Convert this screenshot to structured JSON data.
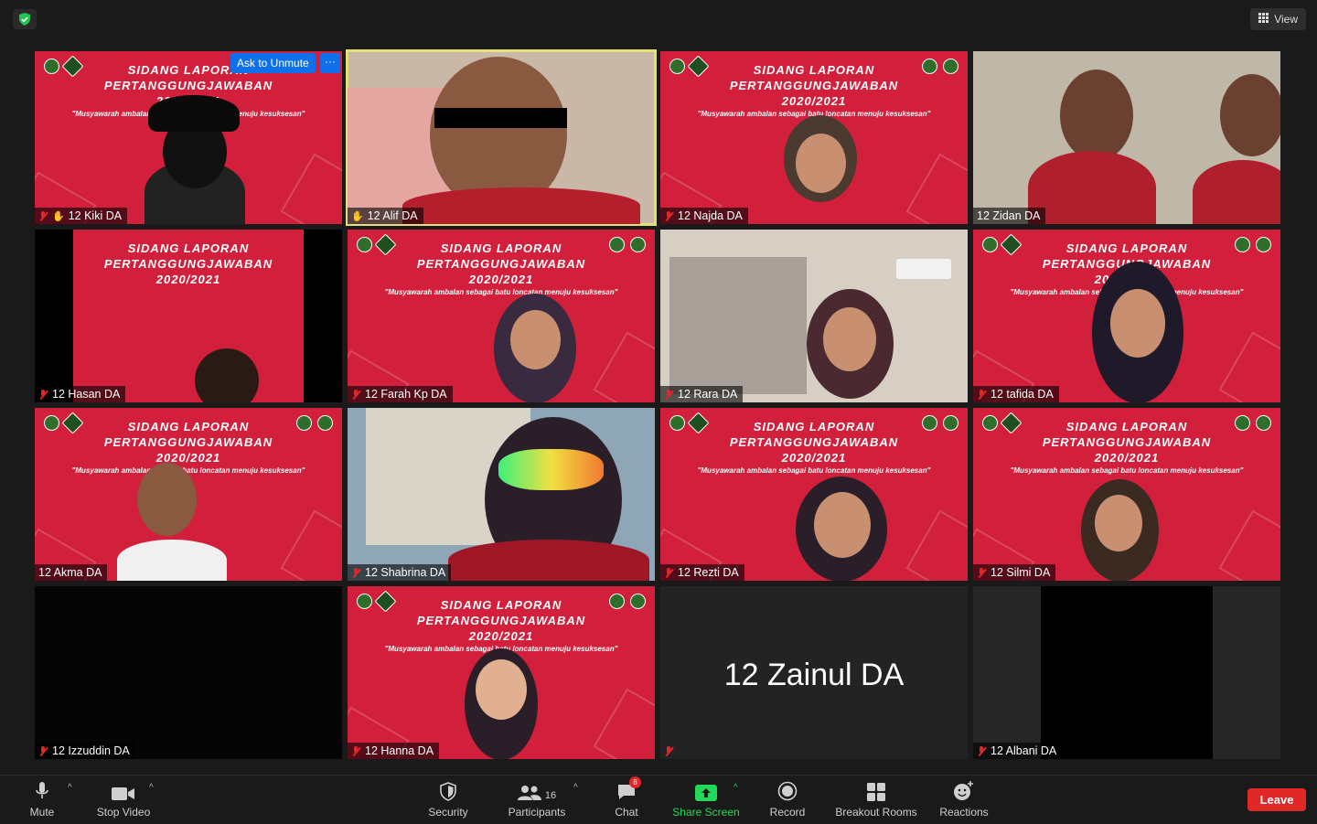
{
  "top": {
    "view_label": "View"
  },
  "tiles": [
    {
      "name": "12 Kiki DA"
    },
    {
      "name": "12 Alif DA"
    },
    {
      "name": "12 Najda DA"
    },
    {
      "name": "12 Zidan DA"
    },
    {
      "name": "12 Hasan DA"
    },
    {
      "name": "12 Farah Kp DA"
    },
    {
      "name": "12 Rara DA"
    },
    {
      "name": "12 tafida DA"
    },
    {
      "name": "12 Akma DA"
    },
    {
      "name": "12 Shabrina DA"
    },
    {
      "name": "12 Rezti DA"
    },
    {
      "name": "12 Silmi DA"
    },
    {
      "name": "12 Izzuddin DA"
    },
    {
      "name": "12 Hanna DA"
    },
    {
      "name": "12 Zainul DA"
    },
    {
      "name": "12 Albani DA"
    }
  ],
  "banner": {
    "line1": "SIDANG LAPORAN",
    "line2": "PERTANGGUNGJAWABAN",
    "line3": "2020/2021",
    "tagline": "\"Musyawarah ambalan sebagai batu loncatan menuju kesuksesan\""
  },
  "overlay": {
    "ask_unmute": "Ask to Unmute",
    "more": "···"
  },
  "toolbar": {
    "mute": "Mute",
    "stop_video": "Stop Video",
    "security": "Security",
    "participants": "Participants",
    "participants_count": "16",
    "chat": "Chat",
    "chat_badge": "8",
    "share_screen": "Share Screen",
    "record": "Record",
    "breakout_rooms": "Breakout Rooms",
    "reactions": "Reactions",
    "leave": "Leave"
  },
  "colors": {
    "banner_red": "#d21f3c",
    "accent_blue": "#0e71eb",
    "share_green": "#23d959",
    "leave_red": "#e02828",
    "active_outline": "#e3e07a"
  }
}
